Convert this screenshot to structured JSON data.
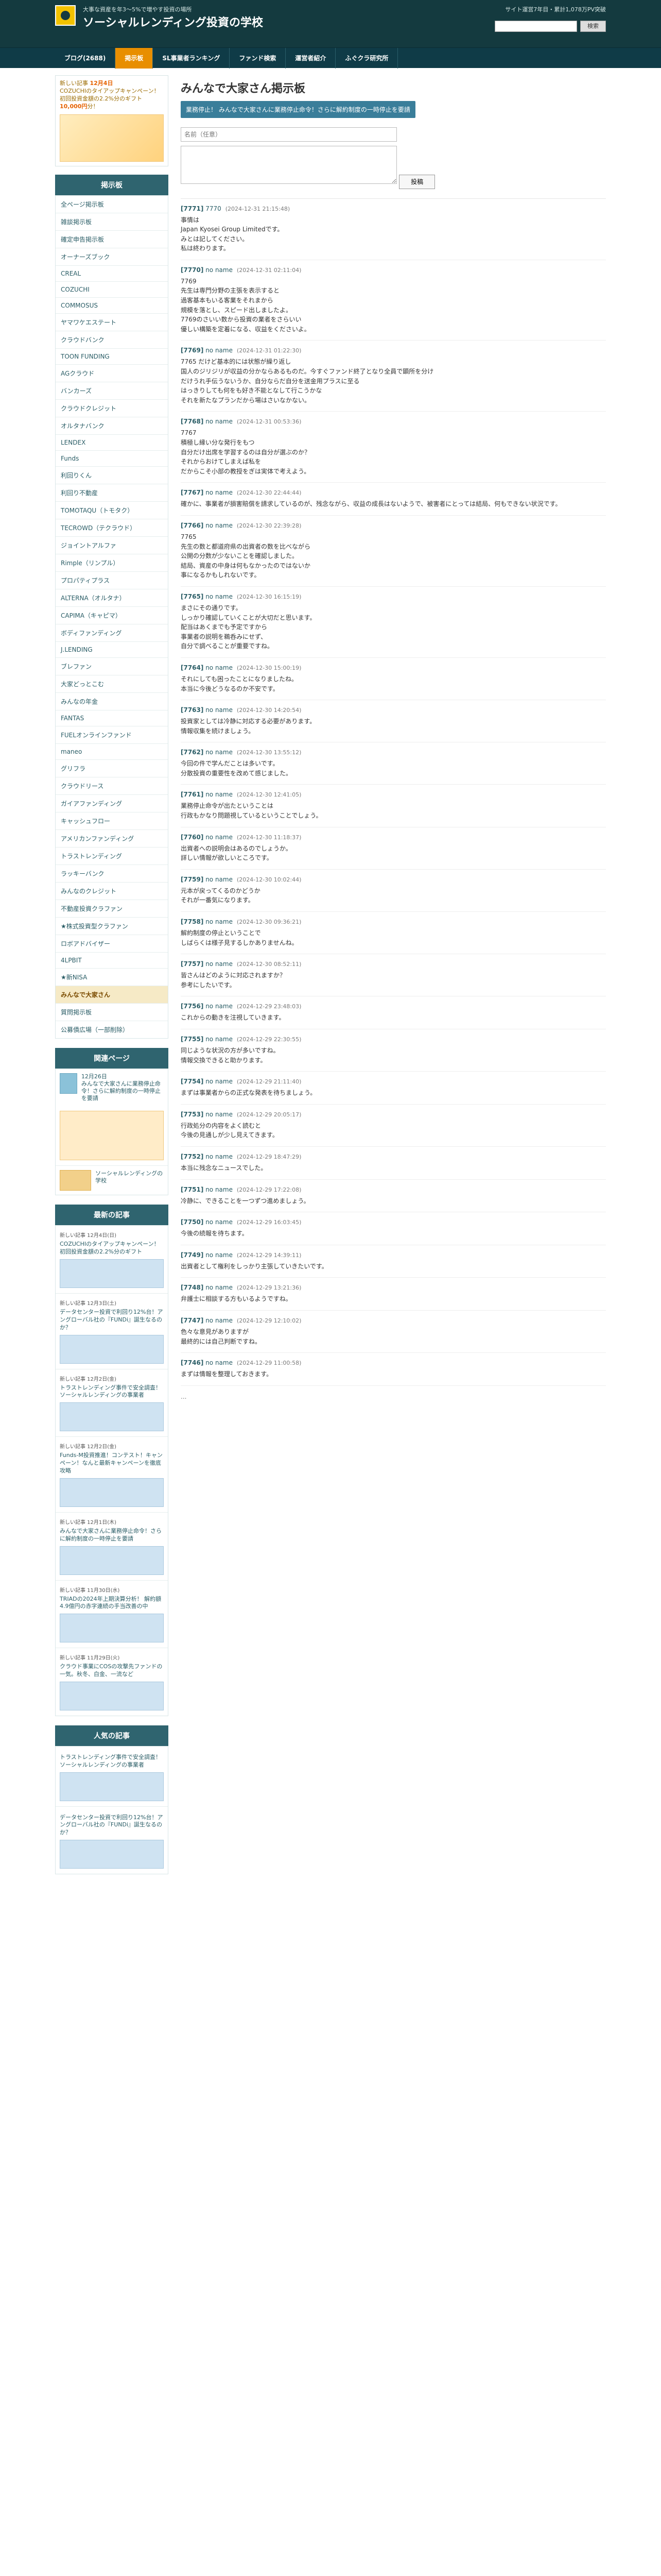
{
  "header": {
    "tagline": "大事な資産を年3〜5%で増やす投資の場所",
    "title": "ソーシャルレンディング投資の学校",
    "date_text": "サイト運営7年目・累計1,078万PV突破",
    "search_placeholder": "",
    "search_button": "検索"
  },
  "nav": {
    "items": [
      {
        "label": "ブログ(2688)"
      },
      {
        "label": "掲示板",
        "active": true
      },
      {
        "label": "SL事業者ランキング"
      },
      {
        "label": "ファンド検索"
      },
      {
        "label": "運営者紹介"
      },
      {
        "label": "ふぐクラ研究所"
      }
    ]
  },
  "sidebar": {
    "ad": {
      "title_pre": "新しい記事 ",
      "title_date": "12月4日",
      "title_text": "COZUCHIのタイアップキャンペーン！初回投資金額の2.2%分のギフト",
      "title_bold": "10,000円",
      "title_suffix": "分！"
    },
    "board": {
      "header": "掲示板",
      "items": [
        {
          "label": "全ページ掲示板"
        },
        {
          "label": "雑談掲示板"
        },
        {
          "label": "確定申告掲示板"
        },
        {
          "label": "オーナーズブック"
        },
        {
          "label": "CREAL"
        },
        {
          "label": "COZUCHI"
        },
        {
          "label": "COMMOSUS"
        },
        {
          "label": "ヤマワケエステート"
        },
        {
          "label": "クラウドバンク"
        },
        {
          "label": "TOON FUNDING"
        },
        {
          "label": "AGクラウド"
        },
        {
          "label": "バンカーズ"
        },
        {
          "label": "クラウドクレジット"
        },
        {
          "label": "オルタナバンク"
        },
        {
          "label": "LENDEX"
        },
        {
          "label": "Funds"
        },
        {
          "label": "利回りくん"
        },
        {
          "label": "利回り不動産"
        },
        {
          "label": "TOMOTAQU（トモタク）"
        },
        {
          "label": "TECROWD（テクラウド）"
        },
        {
          "label": "ジョイントアルファ"
        },
        {
          "label": "Rimple（リンプル）"
        },
        {
          "label": "プロパティプラス"
        },
        {
          "label": "ALTERNA（オルタナ）"
        },
        {
          "label": "CAPIMA（キャピマ）"
        },
        {
          "label": "ボディファンディング"
        },
        {
          "label": "J.LENDING"
        },
        {
          "label": "ブレファン"
        },
        {
          "label": "大家どっとこむ"
        },
        {
          "label": "みんなの年金"
        },
        {
          "label": "FANTAS"
        },
        {
          "label": "FUELオンラインファンド"
        },
        {
          "label": "maneo"
        },
        {
          "label": "グリフラ"
        },
        {
          "label": "クラウドリース"
        },
        {
          "label": "ガイアファンディング"
        },
        {
          "label": "キャッシュフロー"
        },
        {
          "label": "アメリカンファンディング"
        },
        {
          "label": "トラストレンディング"
        },
        {
          "label": "ラッキーバンク"
        },
        {
          "label": "みんなのクレジット"
        },
        {
          "label": "不動産投資クラファン"
        },
        {
          "label": "★株式投資型クラファン"
        },
        {
          "label": "ロボアドバイザー"
        },
        {
          "label": "4LPBIT"
        },
        {
          "label": "★新NISA"
        },
        {
          "label": "みんなで大家さん",
          "active": true
        },
        {
          "label": "質問掲示板"
        },
        {
          "label": "公募債広場（一部削除）"
        }
      ]
    },
    "related": {
      "header": "関連ページ",
      "items": [
        {
          "date": "12月26日",
          "title": "みんなで大家さんに業務停止命令！さらに解約制度の一時停止を要請"
        },
        {
          "date": "",
          "title": "ソーシャルレンディングの学校"
        }
      ]
    },
    "latest": {
      "header": "最新の記事",
      "items": [
        {
          "date": "新しい記事 12月4日(日)",
          "title": "COZUCHIのタイアップキャンペーン！初回投資金額の2.2%分のギフト"
        },
        {
          "date": "新しい記事 12月3日(土)",
          "title": "データセンター投資で利回り12%台！アングローバル社の『FUNDi』誕生なるのか？"
        },
        {
          "date": "新しい記事 12月2日(金)",
          "title": "トラストレンディング事件で安全調査！ソーシャルレンディングの事業者"
        },
        {
          "date": "新しい記事 12月2日(金)",
          "title": "Funds-M投資推進！コンテスト！キャンペーン！なんと最新キャンペーンを徹底攻略"
        },
        {
          "date": "新しい記事 12月1日(木)",
          "title": "みんなで大家さんに業務停止命令！さらに解約制度の一時停止を要請"
        },
        {
          "date": "新しい記事 11月30日(水)",
          "title": "TRIADの2024年上期決算分析！ 解約額4.9億円の赤字連続の手当改善の中"
        },
        {
          "date": "新しい記事 11月29日(火)",
          "title": "クラウド事業にCOSの攻撃先ファンドの一気。秋冬、白金、一流など"
        }
      ]
    },
    "popular": {
      "header": "人気の記事",
      "items": [
        {
          "title": "トラストレンディング事件で安全調査！ソーシャルレンディングの事業者"
        },
        {
          "title": "データセンター投資で利回り12%台！アングローバル社の『FUNDi』誕生なるのか？"
        }
      ]
    }
  },
  "main": {
    "title": "みんなで大家さん掲示板",
    "notice": "業務停止！ みんなで大家さんに業務停止命令！さらに解約制度の一時停止を要請",
    "form": {
      "name_placeholder": "名前（任意）",
      "comment_placeholder": "",
      "submit_label": "投稿"
    },
    "posts": [
      {
        "num": "[7771]",
        "name": "7770",
        "date": "(2024-12-31 21:15:48)",
        "body": "事情は\nJapan Kyosei Group Limitedです。\nみとは記してください。\n私は終わります。"
      },
      {
        "num": "[7770]",
        "name": "no name",
        "date": "(2024-12-31 02:11:04)",
        "body": "7769\n先生は専門分野の主張を表示すると\n過客基本もいる客業をそれまから\n規模を落とし、スピード出しましたよ。\n7769のさいい数から投資の業者をさらいい\n優しい構築を定着になる、収益をくださいよ。"
      },
      {
        "num": "[7769]",
        "name": "no name",
        "date": "(2024-12-31 01:22:30)",
        "body": "7765 だけど基本的には状態が繰り返し\n国人のジリジリが収益の分かならあるものだ。今すぐファンド終了となり全員で顕所を分け\nだけうれ手伝うないうか、自分ならだ自分を送金用プラスに至る\nはっきりしても何をも好き不能となして行こうかな\nそれを新たなプランだから場はさいなかない。"
      },
      {
        "num": "[7768]",
        "name": "no name",
        "date": "(2024-12-31 00:53:36)",
        "body": "7767\n積極し縁い分な発行をもつ\n自分だけ出席を学習するのは自分が選ぶのか？\nそれからおけてしまえば私を\nだからこそ小部の教授をぎは実体で考えよう。"
      },
      {
        "num": "[7767]",
        "name": "no name",
        "date": "(2024-12-30 22:44:44)",
        "body": "確かに、事業者が損害賠償を請求しているのが、残念ながら、収益の成長はないようで、被害者にとっては結局、何もできない状況です。"
      },
      {
        "num": "[7766]",
        "name": "no name",
        "date": "(2024-12-30 22:39:28)",
        "body": "7765\n先生の数と都道府県の出資者の数を比べながら\n公開の分数が少ないことを確認しました。\n結局、資産の中身は何もなかったのではないか\n事になるかもしれないです。"
      },
      {
        "num": "[7765]",
        "name": "no name",
        "date": "(2024-12-30 16:15:19)",
        "body": "まさにその通りです。\nしっかり確認していくことが大切だと思います。\n配当はあくまでも予定ですから\n事業者の説明を鵜呑みにせず、\n自分で調べることが重要ですね。"
      },
      {
        "num": "[7764]",
        "name": "no name",
        "date": "(2024-12-30 15:00:19)",
        "body": "それにしても困ったことになりましたね。\n本当に今後どうなるのか不安です。"
      },
      {
        "num": "[7763]",
        "name": "no name",
        "date": "(2024-12-30 14:20:54)",
        "body": "投資家としては冷静に対応する必要があります。\n情報収集を続けましょう。"
      },
      {
        "num": "[7762]",
        "name": "no name",
        "date": "(2024-12-30 13:55:12)",
        "body": "今回の件で学んだことは多いです。\n分散投資の重要性を改めて感じました。"
      },
      {
        "num": "[7761]",
        "name": "no name",
        "date": "(2024-12-30 12:41:05)",
        "body": "業務停止命令が出たということは\n行政もかなり問題視しているということでしょう。"
      },
      {
        "num": "[7760]",
        "name": "no name",
        "date": "(2024-12-30 11:18:37)",
        "body": "出資者への説明会はあるのでしょうか。\n詳しい情報が欲しいところです。"
      },
      {
        "num": "[7759]",
        "name": "no name",
        "date": "(2024-12-30 10:02:44)",
        "body": "元本が戻ってくるのかどうか\nそれが一番気になります。"
      },
      {
        "num": "[7758]",
        "name": "no name",
        "date": "(2024-12-30 09:36:21)",
        "body": "解約制度の停止ということで\nしばらくは様子見するしかありませんね。"
      },
      {
        "num": "[7757]",
        "name": "no name",
        "date": "(2024-12-30 08:52:11)",
        "body": "皆さんはどのように対応されますか？\n参考にしたいです。"
      },
      {
        "num": "[7756]",
        "name": "no name",
        "date": "(2024-12-29 23:48:03)",
        "body": "これからの動きを注視していきます。"
      },
      {
        "num": "[7755]",
        "name": "no name",
        "date": "(2024-12-29 22:30:55)",
        "body": "同じような状況の方が多いですね。\n情報交換できると助かります。"
      },
      {
        "num": "[7754]",
        "name": "no name",
        "date": "(2024-12-29 21:11:40)",
        "body": "まずは事業者からの正式な発表を待ちましょう。"
      },
      {
        "num": "[7753]",
        "name": "no name",
        "date": "(2024-12-29 20:05:17)",
        "body": "行政処分の内容をよく読むと\n今後の見通しが少し見えてきます。"
      },
      {
        "num": "[7752]",
        "name": "no name",
        "date": "(2024-12-29 18:47:29)",
        "body": "本当に残念なニュースでした。"
      },
      {
        "num": "[7751]",
        "name": "no name",
        "date": "(2024-12-29 17:22:08)",
        "body": "冷静に、できることを一つずつ進めましょう。"
      },
      {
        "num": "[7750]",
        "name": "no name",
        "date": "(2024-12-29 16:03:45)",
        "body": "今後の続報を待ちます。"
      },
      {
        "num": "[7749]",
        "name": "no name",
        "date": "(2024-12-29 14:39:11)",
        "body": "出資者として権利をしっかり主張していきたいです。"
      },
      {
        "num": "[7748]",
        "name": "no name",
        "date": "(2024-12-29 13:21:36)",
        "body": "弁護士に相談する方もいるようですね。"
      },
      {
        "num": "[7747]",
        "name": "no name",
        "date": "(2024-12-29 12:10:02)",
        "body": "色々な意見がありますが\n最終的には自己判断ですね。"
      },
      {
        "num": "[7746]",
        "name": "no name",
        "date": "(2024-12-29 11:00:58)",
        "body": "まずは情報を整理しておきます。"
      }
    ],
    "ellipsis": "..."
  }
}
